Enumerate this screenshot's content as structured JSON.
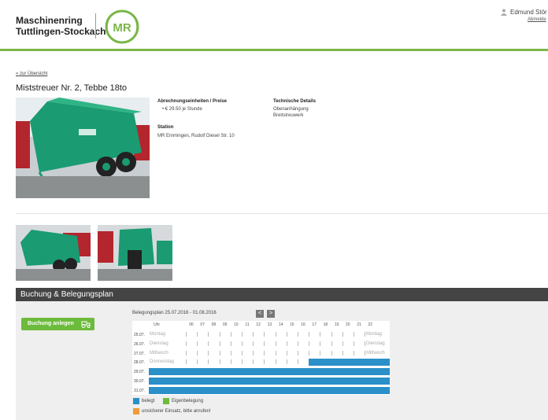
{
  "header": {
    "brand_line1": "Maschinenring",
    "brand_line2": "Tuttlingen-Stockach",
    "logo_text": "MR",
    "user_name": "Edmund Stör",
    "logout": "Abmelde",
    "accent_color": "#7ab648"
  },
  "nav": {
    "back_link": "« zur Übersicht"
  },
  "item": {
    "title": "Miststreuer Nr. 2, Tebbe 18to",
    "billing_heading": "Abrechnungseinheiten / Preise",
    "price": "• € 29.50 je Stunde",
    "station_heading": "Station",
    "station": "MR Emmingen, Rudolf Diesel Str. 10",
    "tech_heading": "Technische Details",
    "tech_lines": [
      "Obenanhängung",
      "Breitstreuwerk"
    ]
  },
  "booking": {
    "section_title": "Buchung & Belegungsplan",
    "book_button": "Buchung anlegen",
    "plan_title": "Belegungsplan 25.07.2016 - 01.08.2016",
    "prev": "<",
    "next": ">",
    "header_label": "Uhr",
    "hours": [
      "06",
      "07",
      "08",
      "09",
      "10",
      "11",
      "12",
      "13",
      "14",
      "15",
      "16",
      "17",
      "18",
      "19",
      "20",
      "21",
      "22"
    ],
    "rows": [
      {
        "date": "25.07.",
        "day": "Montag",
        "day_right": "Montag"
      },
      {
        "date": "26.07.",
        "day": "Dienstag",
        "day_right": "Dienstag"
      },
      {
        "date": "27.07.",
        "day": "Mittwoch",
        "day_right": "Mittwoch"
      },
      {
        "date": "28.07.",
        "day": "Donnerstag",
        "day_right": ""
      },
      {
        "date": "29.07.",
        "day": "",
        "day_right": ""
      },
      {
        "date": "30.07.",
        "day": "",
        "day_right": ""
      },
      {
        "date": "31.07.",
        "day": "",
        "day_right": ""
      }
    ],
    "legend": {
      "booked": "belegt",
      "own": "Eigenbelegung",
      "uncertain": "unsicherer Einsatz, bitte anrufen!",
      "booked_color": "#2b8fc8",
      "own_color": "#6dbb3c",
      "uncertain_color": "#f29a3a"
    }
  }
}
